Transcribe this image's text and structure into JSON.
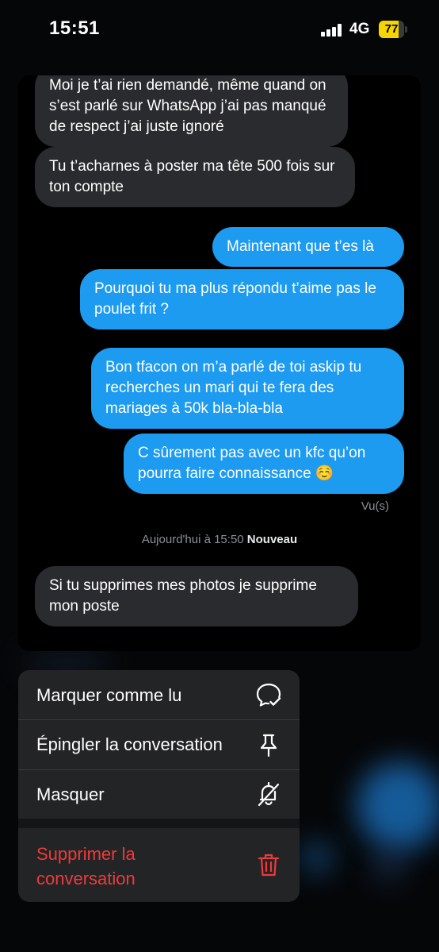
{
  "status_bar": {
    "time": "15:51",
    "network": "4G",
    "battery": "77",
    "battery_level": 0.77
  },
  "conversation": {
    "messages": [
      {
        "direction": "in",
        "text": "Moi je t’ai rien demandé, même quand on s’est parlé sur WhatsApp j’ai pas manqué de respect j’ai juste ignoré"
      },
      {
        "direction": "in",
        "text": "Tu t’acharnes à poster ma tête 500 fois sur ton compte"
      },
      {
        "direction": "out",
        "text": "Maintenant que t’es là"
      },
      {
        "direction": "out",
        "text": "Pourquoi tu ma plus répondu t’aime pas le poulet frit ?"
      },
      {
        "direction": "out",
        "text": "Bon tfacon on m’a parlé de toi askip tu recherches un mari qui te fera des mariages à 50k bla-bla-bla"
      },
      {
        "direction": "out",
        "text": "C sûrement pas avec un kfc qu’on pourra faire connaissance ☺️"
      },
      {
        "direction": "in",
        "text": "Si tu supprimes mes photos je supprime mon poste"
      }
    ],
    "seen_label": "Vu(s)",
    "divider_date": "Aujourd'hui à 15:50",
    "divider_new": "Nouveau"
  },
  "context_menu": {
    "items": [
      {
        "label": "Marquer comme lu",
        "icon": "chat-check-icon"
      },
      {
        "label": "Épingler la conversation",
        "icon": "pin-icon"
      },
      {
        "label": "Masquer",
        "icon": "bell-slash-icon"
      },
      {
        "label": "Supprimer la conversation",
        "icon": "trash-icon",
        "destructive": true
      }
    ]
  },
  "colors": {
    "outgoing_bubble": "#1d9bf0",
    "incoming_bubble": "#2a2b2f",
    "destructive": "#ee3b3b"
  }
}
